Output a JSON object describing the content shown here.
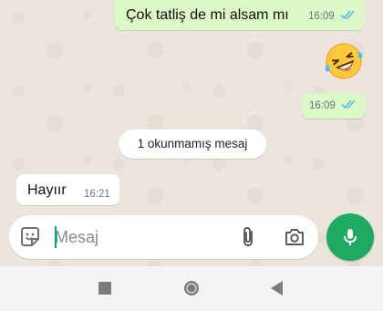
{
  "messages": [
    {
      "text": "Çok tatliş de mi alsam mı",
      "time": "16:09",
      "direction": "outgoing",
      "status": "read"
    },
    {
      "emoji": "🤣",
      "direction": "incoming"
    },
    {
      "text": "",
      "time": "16:09",
      "direction": "outgoing",
      "status": "read"
    },
    {
      "text": "Hayıır",
      "time": "16:21",
      "direction": "incoming"
    }
  ],
  "unread_banner": "1 okunmamış mesaj",
  "composer": {
    "placeholder": "Mesaj",
    "sticker_icon": "sticker-icon",
    "attach_icon": "paperclip-icon",
    "camera_icon": "camera-icon"
  },
  "mic_icon": "microphone-icon",
  "navbar": {
    "icons": [
      "recent-apps-icon",
      "home-icon",
      "back-icon"
    ]
  },
  "colors": {
    "outgoing_bubble": "#dcf8c6",
    "incoming_bubble": "#ffffff",
    "accent": "#1faa61",
    "read_ticks": "#53bdeb",
    "chat_background": "#ece5dd"
  }
}
